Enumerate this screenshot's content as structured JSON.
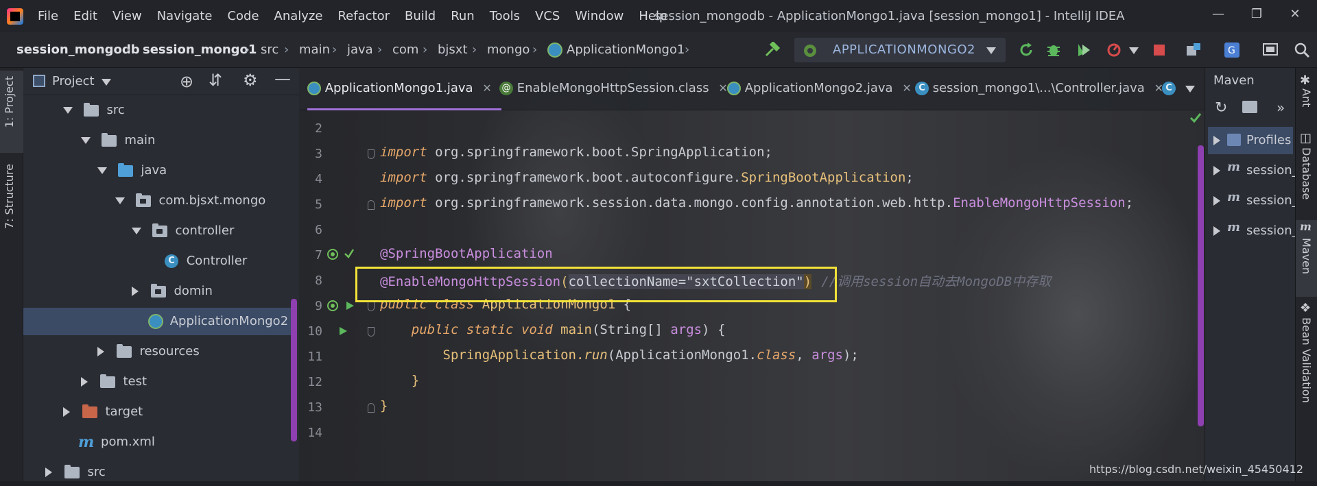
{
  "window_title": "session_mongodb - ApplicationMongo1.java [session_mongo1] - IntelliJ IDEA",
  "menu": [
    "File",
    "Edit",
    "View",
    "Navigate",
    "Code",
    "Analyze",
    "Refactor",
    "Build",
    "Run",
    "Tools",
    "VCS",
    "Window",
    "Help"
  ],
  "breadcrumb": [
    "session_mongodb",
    "session_mongo1",
    "src",
    "main",
    "java",
    "com",
    "bjsxt",
    "mongo",
    "ApplicationMongo1"
  ],
  "run_config": "APPLICATIONMONGO2",
  "left_tabs": [
    "1: Project",
    "7: Structure"
  ],
  "project": {
    "title": "Project",
    "tree": [
      {
        "label": "src"
      },
      {
        "label": "main"
      },
      {
        "label": "java"
      },
      {
        "label": "com.bjsxt.mongo"
      },
      {
        "label": "controller"
      },
      {
        "label": "Controller"
      },
      {
        "label": "domin"
      },
      {
        "label": "ApplicationMongo2"
      },
      {
        "label": "resources"
      },
      {
        "label": "test"
      },
      {
        "label": "target"
      },
      {
        "label": "pom.xml"
      },
      {
        "label": "src"
      }
    ]
  },
  "editor": {
    "tabs": [
      "ApplicationMongo1.java",
      "EnableMongoHttpSession.class",
      "ApplicationMongo2.java",
      "session_mongo1\\...\\Controller.java"
    ],
    "line_numbers": [
      "2",
      "3",
      "4",
      "5",
      "6",
      "7",
      "8",
      "9",
      "10",
      "11",
      "12",
      "13",
      "14"
    ],
    "code": {
      "l3_kw": "import",
      "l3_rest": " org.springframework.boot.SpringApplication;",
      "l4_kw": "import",
      "l4_pkg": " org.springframework.boot.autoconfigure.",
      "l4_cls": "SpringBootApplication",
      "l4_end": ";",
      "l5_kw": "import",
      "l5_pkg": " org.springframework.session.data.mongo.config.annotation.web.http.",
      "l5_cls": "EnableMongoHttpSession",
      "l5_end": ";",
      "l7": "@SpringBootApplication",
      "l8_ann": "@EnableMongoHttpSession",
      "l8_open": "(",
      "l8_attr": "collectionName=\"sxtCollection\"",
      "l8_close": ")",
      "l8_cmt": "//调用session自动去MongoDB中存取",
      "l9_kw1": "public",
      "l9_kw2": "class",
      "l9_name": "ApplicationMongo1",
      "l9_brace": " {",
      "l10_kw1": "public",
      "l10_kw2": "static",
      "l10_kw3": "void",
      "l10_fn": "main",
      "l10_params": "(String[] ",
      "l10_args": "args",
      "l10_end": ") {",
      "l11_cls": "SpringApplication.",
      "l11_fn": "run",
      "l11_mid": "(ApplicationMongo1.",
      "l11_kw": "class",
      "l11_sep": ", ",
      "l11_args": "args",
      "l11_end": ");",
      "l12": "}",
      "l13": "}"
    }
  },
  "maven": {
    "title": "Maven",
    "items": [
      "Profiles",
      "session_",
      "session_",
      "session_"
    ]
  },
  "right_tabs": [
    "Ant",
    "Database",
    "Maven",
    "Bean Validation"
  ],
  "watermark": "https://blog.csdn.net/weixin_45450412"
}
